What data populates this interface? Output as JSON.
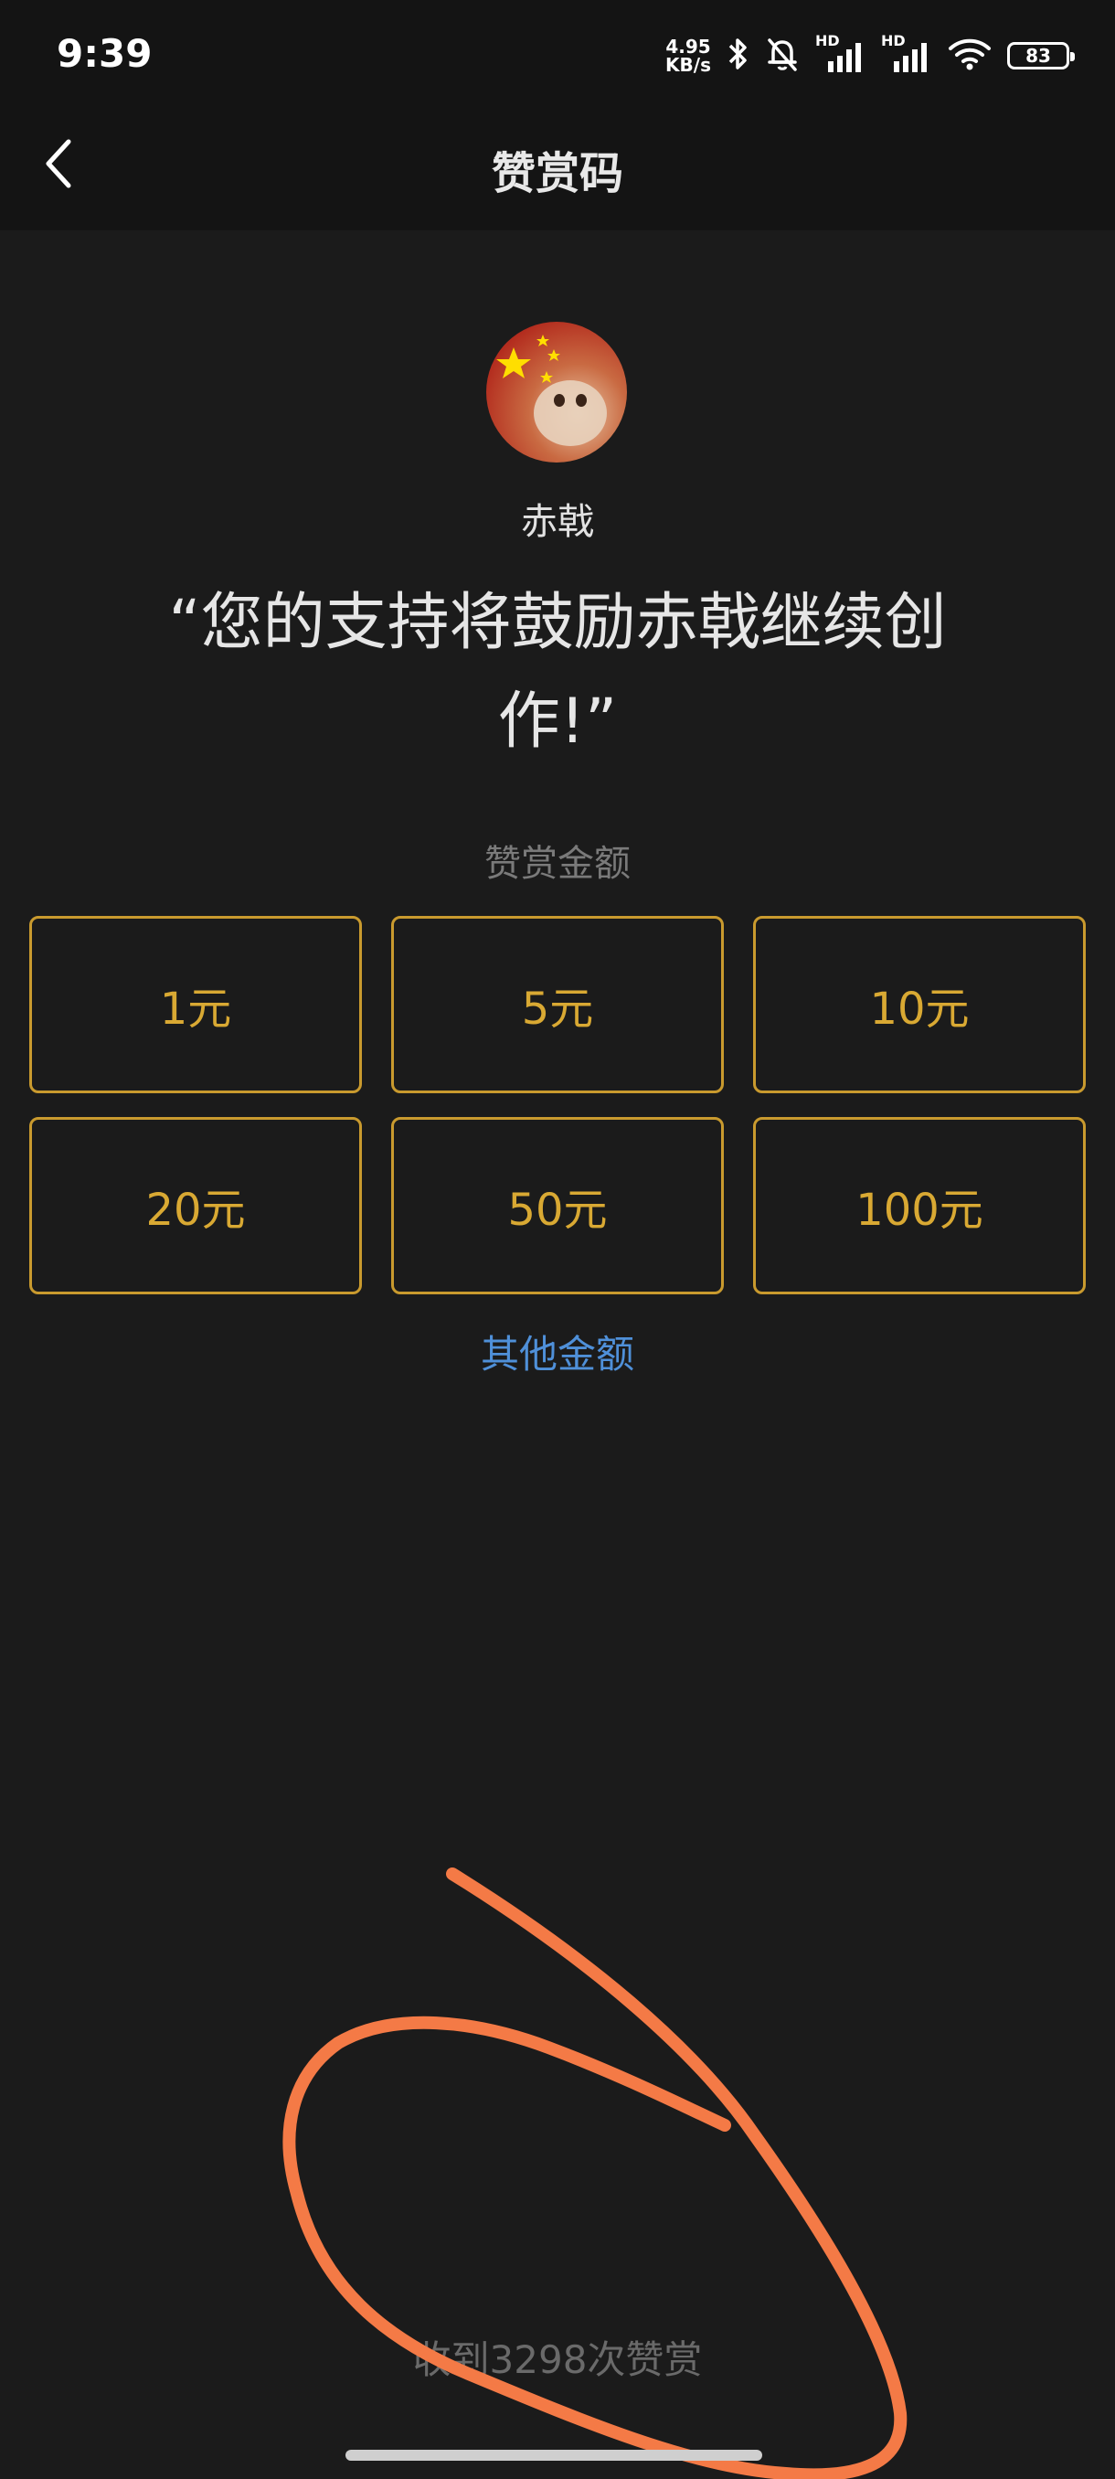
{
  "status_bar": {
    "time": "9:39",
    "net_speed_value": "4.95",
    "net_speed_unit": "KB/s",
    "signal_1_label": "HD",
    "signal_2_label": "HD",
    "battery": "83",
    "icons": [
      "bluetooth-icon",
      "mute-bell-icon",
      "signal-icon",
      "signal-icon",
      "wifi-icon",
      "battery-icon"
    ]
  },
  "header": {
    "title": "赞赏码"
  },
  "profile": {
    "name": "赤戟",
    "quote": "“您的支持将鼓励赤戟继续创作!”"
  },
  "amounts": {
    "label": "赞赏金额",
    "options": [
      "1元",
      "5元",
      "10元",
      "20元",
      "50元",
      "100元"
    ],
    "other_label": "其他金额"
  },
  "footer": {
    "reward_count": "收到3298次赞赏"
  },
  "colors": {
    "background": "#1b1b1b",
    "amount_accent": "#d9a933",
    "link_blue": "#4f90d9",
    "annotation_orange": "#f47a46"
  }
}
